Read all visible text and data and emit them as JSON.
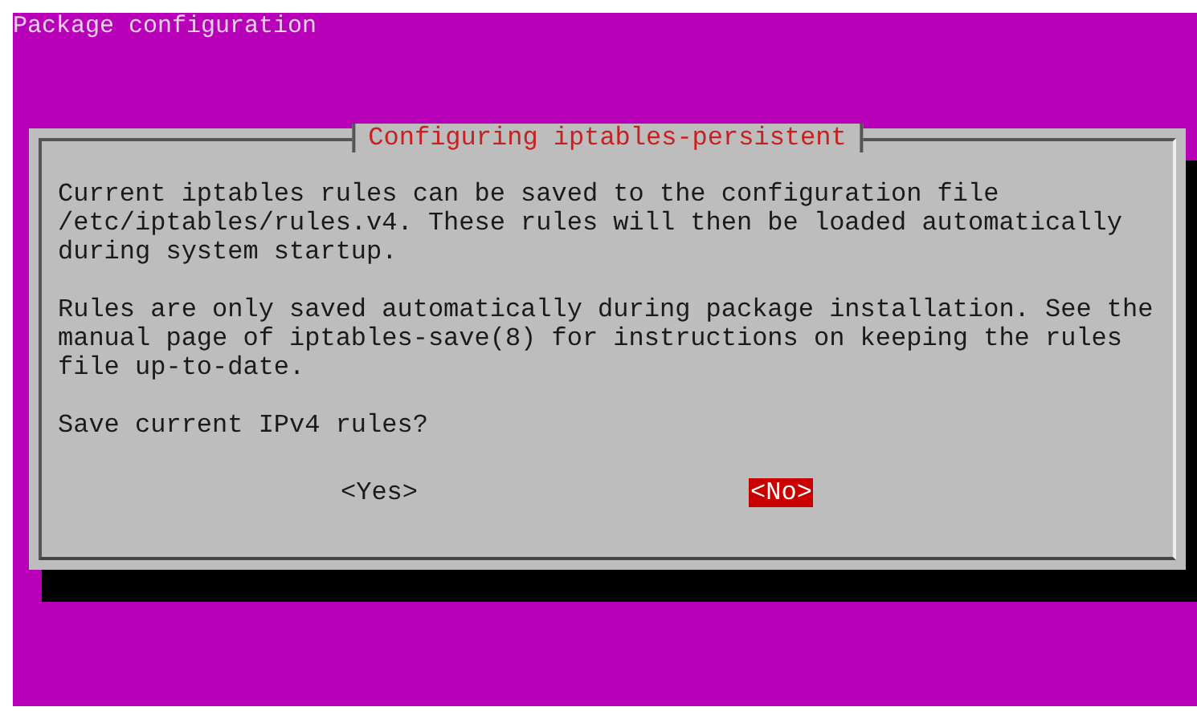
{
  "screen": {
    "title": "Package configuration"
  },
  "dialog": {
    "title": "Configuring iptables-persistent",
    "paragraphs": [
      "Current iptables rules can be saved to the configuration file\n/etc/iptables/rules.v4. These rules will then be loaded automatically\nduring system startup.",
      "Rules are only saved automatically during package installation. See the\nmanual page of iptables-save(8) for instructions on keeping the rules\nfile up-to-date.",
      "Save current IPv4 rules?"
    ],
    "buttons": [
      {
        "label": "<Yes>",
        "selected": false
      },
      {
        "label": "<No>",
        "selected": true
      }
    ]
  }
}
